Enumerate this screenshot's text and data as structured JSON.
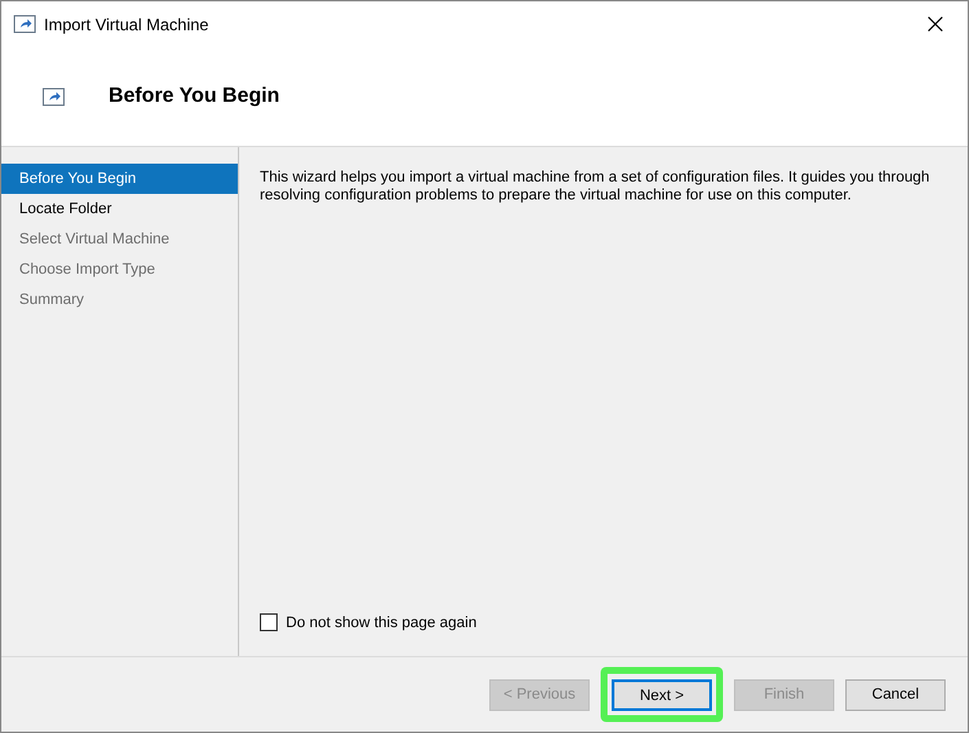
{
  "window": {
    "title": "Import Virtual Machine"
  },
  "header": {
    "title": "Before You Begin"
  },
  "steps": [
    {
      "label": "Before You Begin",
      "selected": true,
      "disabled": false
    },
    {
      "label": "Locate Folder",
      "selected": false,
      "disabled": false
    },
    {
      "label": "Select Virtual Machine",
      "selected": false,
      "disabled": true
    },
    {
      "label": "Choose Import Type",
      "selected": false,
      "disabled": true
    },
    {
      "label": "Summary",
      "selected": false,
      "disabled": true
    }
  ],
  "description": "This wizard helps you import a virtual machine from a set of configuration files. It guides you through resolving configuration problems to prepare the virtual machine for use on this computer.",
  "dont_show_again": {
    "label": "Do not show this page again",
    "checked": false
  },
  "buttons": [
    {
      "label": "< Previous",
      "disabled": true,
      "default": false,
      "highlighted": false
    },
    {
      "label": "Next >",
      "disabled": false,
      "default": true,
      "highlighted": true
    },
    {
      "label": "Finish",
      "disabled": true,
      "default": false,
      "highlighted": false
    },
    {
      "label": "Cancel",
      "disabled": false,
      "default": false,
      "highlighted": false
    }
  ]
}
